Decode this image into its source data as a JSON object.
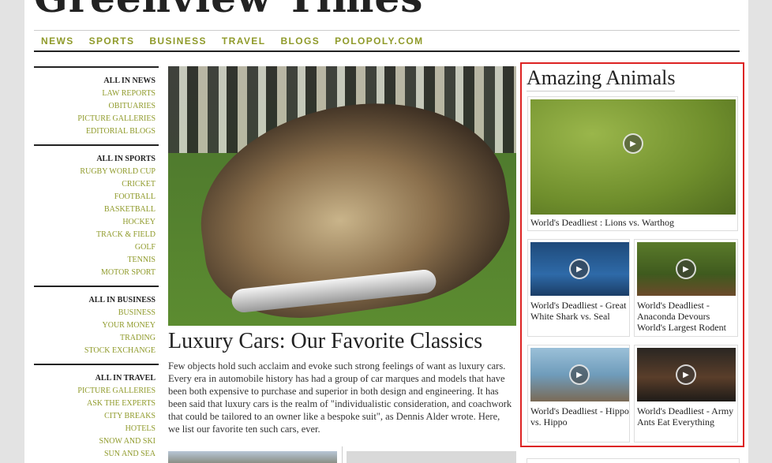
{
  "site": {
    "masthead": "Greenview Times"
  },
  "topnav": [
    "NEWS",
    "SPORTS",
    "BUSINESS",
    "TRAVEL",
    "BLOGS",
    "POLOPOLY.COM"
  ],
  "sidebar": {
    "groups": [
      {
        "head": "ALL IN NEWS",
        "links": [
          "LAW REPORTS",
          "OBITUARIES",
          "PICTURE GALLERIES",
          "EDITORIAL BLOGS"
        ]
      },
      {
        "head": "ALL IN SPORTS",
        "links": [
          "RUGBY WORLD CUP",
          "CRICKET",
          "FOOTBALL",
          "BASKETBALL",
          "HOCKEY",
          "TRACK & FIELD",
          "GOLF",
          "TENNIS",
          "MOTOR SPORT"
        ]
      },
      {
        "head": "ALL IN BUSINESS",
        "links": [
          "BUSINESS",
          "YOUR MONEY",
          "TRADING",
          "STOCK EXCHANGE"
        ]
      },
      {
        "head": "ALL IN TRAVEL",
        "links": [
          "PICTURE GALLERIES",
          "ASK THE EXPERTS",
          "CITY BREAKS",
          "HOTELS",
          "SNOW AND SKI",
          "SUN AND SEA"
        ]
      }
    ]
  },
  "main": {
    "headline": "Luxury Cars: Our Favorite Classics",
    "lede": "Few objects hold such acclaim and evoke such strong feelings of want as luxury cars. Every era in automobile history has had a group of car marques and models that have been both expensive to purchase and superior in both design and engineering. It has been said that luxury cars is the realm of \"individualistic consideration, and coachwork that could be tailored to an owner like a bespoke suit\", as Dennis Alder wrote. Here, we list our favorite ten such cars, ever."
  },
  "widget": {
    "title": "Amazing Animals",
    "videos": [
      "World's Deadliest : Lions vs. Warthog",
      "World's Deadliest - Great White Shark vs. Seal",
      "World's Deadliest - Anaconda Devours World's Largest Rodent",
      "World's Deadliest - Hippo vs. Hippo",
      "World's Deadliest - Army Ants Eat Everything"
    ],
    "play_glyph": "▶"
  },
  "colors": {
    "nav": "#8f9a2a",
    "highlight_border": "#dd2222"
  }
}
